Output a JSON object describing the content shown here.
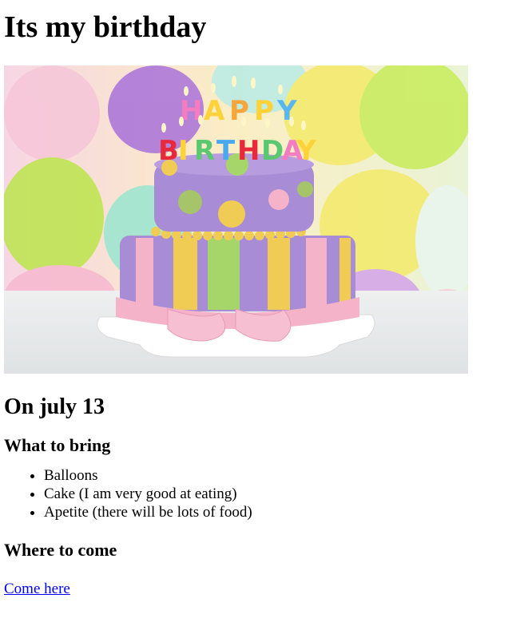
{
  "page": {
    "title": "Its my birthday",
    "date_heading": "On july 13",
    "bring_heading": "What to bring",
    "bring_items": [
      "Balloons",
      "Cake (I am very good at eating)",
      "Apetite (there will be lots of food)"
    ],
    "where_heading": "Where to come",
    "link_text": "Come here"
  },
  "image": {
    "candle_letters_top": [
      "H",
      "A",
      "P",
      "P",
      "Y"
    ],
    "candle_letters_bottom": [
      "B",
      "I",
      "R",
      "T",
      "H",
      "D",
      "A",
      "Y"
    ]
  },
  "colors": {
    "link": "#0000ee",
    "text": "#000000",
    "cake_purple": "#a98cd6",
    "ribbon_pink": "#f4b3c9"
  }
}
